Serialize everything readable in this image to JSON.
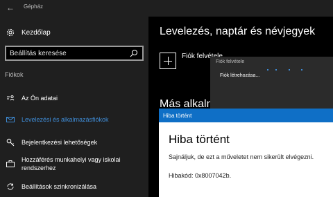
{
  "window": {
    "title": "Gépház",
    "back_icon": "back-arrow-icon"
  },
  "sidebar": {
    "home_label": "Kezdőlap",
    "search_placeholder": "Beállítás keresése",
    "section": "Fiókok",
    "items": [
      {
        "label": "Az Ön adatai",
        "icon": "person-card-icon"
      },
      {
        "label": "Levelezési és alkalmazásfiókok",
        "icon": "mail-icon",
        "active": true
      },
      {
        "label": "Bejelentkezési lehetőségek",
        "icon": "key-icon"
      },
      {
        "label": "Hozzáférés munkahelyi vagy iskolai",
        "label2": "rendszerhez",
        "icon": "briefcase-icon"
      },
      {
        "label": "Beállítások szinkronizálása",
        "icon": "sync-icon"
      }
    ],
    "accent_color": "#3f8cd6"
  },
  "main": {
    "title": "Levelezés, naptár és névjegyek",
    "add_label": "Fiók felvétele",
    "other_heading": "Más alkalmazásokban használt fiókok"
  },
  "account_popup": {
    "title": "Fiók felvétele",
    "body": "Fiók létrehozása..."
  },
  "error_dialog": {
    "bar_title": "Hiba történt",
    "heading": "Hiba történt",
    "message": "Sajnáljuk, de ezt a műveletet nem sikerült elvégezni.",
    "code": "Hibakód: 0x8007042b.",
    "bar_color": "#0f6fc6"
  }
}
